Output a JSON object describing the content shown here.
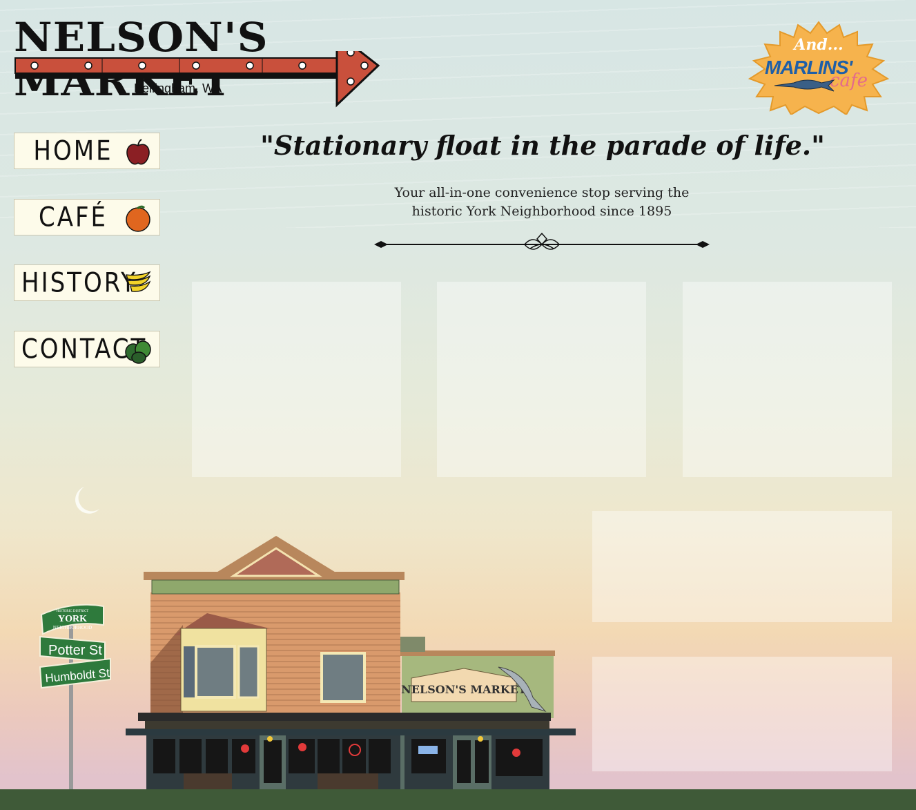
{
  "header": {
    "logo_title": "NELSON'S MARKET",
    "logo_city": "Bellingham, WA",
    "badge_and": "And...",
    "badge_name": "MARLINS'",
    "badge_cafe": "cafe"
  },
  "nav": {
    "items": [
      {
        "label": "HOME",
        "icon": "apple-icon"
      },
      {
        "label": "CAFÉ",
        "icon": "orange-icon"
      },
      {
        "label": "HISTORY",
        "icon": "banana-icon"
      },
      {
        "label": "CONTACT",
        "icon": "limes-icon"
      }
    ]
  },
  "hero": {
    "tagline": "\"Stationary float in the parade of life.\"",
    "subtitle_line1": "Your all-in-one convenience stop serving the",
    "subtitle_line2": "historic York Neighborhood since 1895"
  },
  "scene": {
    "sign_district": "HISTORIC DISTRICT",
    "sign_neighborhood": "YORK",
    "sign_neighborhood_sub": "NEIGHBORHOOD",
    "street1": "Potter St",
    "street2": "Humboldt St",
    "storefront_sign": "NELSON'S MARKET"
  },
  "colors": {
    "arrow_red": "#c9503c",
    "badge_orange": "#f6b34d",
    "nav_bg": "#fdfbea",
    "ground": "#3f5a38",
    "street_sign_green": "#2e7a3c"
  }
}
